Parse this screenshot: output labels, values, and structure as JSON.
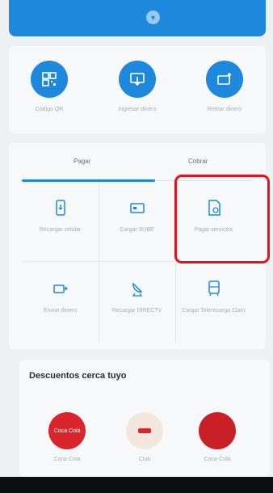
{
  "header": {
    "expand_icon": "chevron-down-icon"
  },
  "shortcuts": [
    {
      "label": "Código QR",
      "icon": "qr-code-icon"
    },
    {
      "label": "Ingresar dinero",
      "icon": "deposit-icon"
    },
    {
      "label": "Retirar dinero",
      "icon": "withdraw-icon"
    }
  ],
  "tabs": {
    "pay": "Pagar",
    "collect": "Cobrar"
  },
  "services": [
    {
      "label": "Recargar celular",
      "icon": "mobile-recharge-icon"
    },
    {
      "label": "Cargar SUBE",
      "icon": "sube-card-icon"
    },
    {
      "label": "Pagar servicios",
      "icon": "pay-services-icon"
    },
    {
      "label": "Enviar dinero",
      "icon": "send-money-icon"
    },
    {
      "label": "Recargar DIRECTV",
      "icon": "satellite-icon"
    },
    {
      "label": "Cargar Telerecarga Claro",
      "icon": "transport-card-icon"
    }
  ],
  "discounts": {
    "title": "Descuentos cerca tuyo",
    "items": [
      {
        "label": "Coca-Cola",
        "color": "#d9252b",
        "logo_text": "Coca Cola"
      },
      {
        "label": "Club",
        "color": "#f3e6dd",
        "logo_text": ""
      },
      {
        "label": "Coca-Cola",
        "color": "#c92027",
        "logo_text": ""
      }
    ]
  },
  "colors": {
    "accent": "#1e88dd",
    "highlight": "#e8101b"
  }
}
